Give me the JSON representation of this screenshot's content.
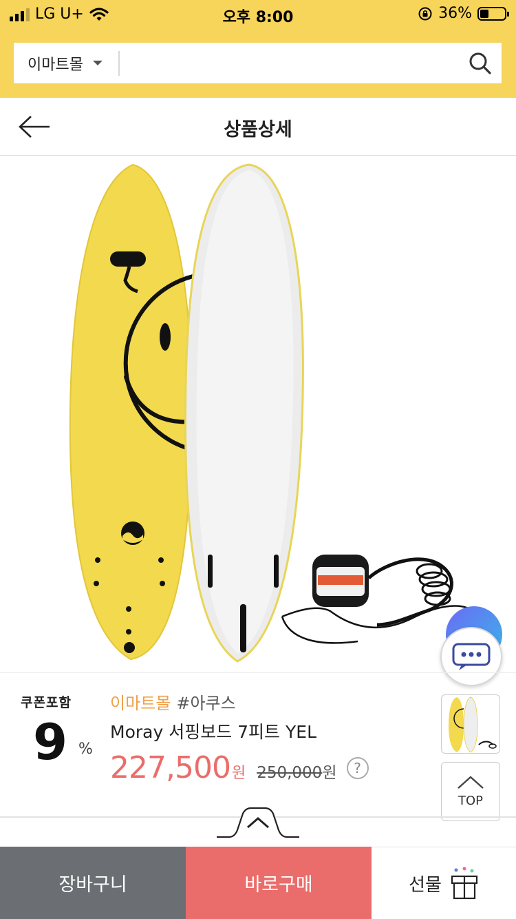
{
  "status_bar": {
    "carrier": "LG U+",
    "time": "오후 8:00",
    "battery_percent": "36%",
    "battery_level": 0.36
  },
  "search": {
    "mall_selector": "이마트몰",
    "placeholder": ""
  },
  "header": {
    "title": "상품상세"
  },
  "product": {
    "coupon_label": "쿠폰포함",
    "coupon_rate": "9",
    "coupon_unit": "%",
    "seller": "이마트몰",
    "brand_tag": "#아쿠스",
    "name": "Moray 서핑보드 7피트 YEL",
    "price": "227,500",
    "price_unit": "원",
    "original_price": "250,000",
    "original_price_unit": "원",
    "help_label": "?"
  },
  "floating": {
    "top_label": "TOP",
    "chat_icon": "chat-bubble-icon"
  },
  "bottom_bar": {
    "cart_label": "장바구니",
    "buy_label": "바로구매",
    "gift_label": "선물"
  },
  "colors": {
    "header_yellow": "#f7d45a",
    "price_red": "#ea6d6b",
    "seller_orange": "#f0a048",
    "cart_gray": "#6b6f73"
  }
}
